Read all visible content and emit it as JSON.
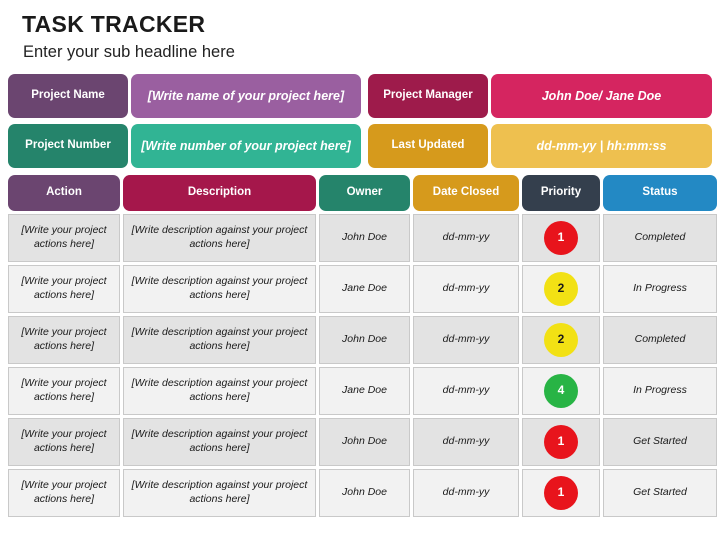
{
  "header": {
    "title": "TASK TRACKER",
    "subtitle": "Enter your sub headline here"
  },
  "meta": {
    "rows": [
      {
        "left": {
          "label": "Project Name",
          "value": "[Write name of your project here]",
          "label_color": "#6B4570",
          "value_color": "#9A5FA0"
        },
        "right": {
          "label": "Project Manager",
          "value": "John Doe/ Jane Doe",
          "label_color": "#9E1B4B",
          "value_color": "#D52560"
        }
      },
      {
        "left": {
          "label": "Project Number",
          "value": "[Write number of your project here]",
          "label_color": "#25846B",
          "value_color": "#31B494"
        },
        "right": {
          "label": "Last Updated",
          "value": "dd-mm-yy | hh:mm:ss",
          "label_color": "#D69A1C",
          "value_color": "#EEC04F"
        }
      }
    ]
  },
  "table": {
    "columns": [
      {
        "label": "Action",
        "color": "#6B4570"
      },
      {
        "label": "Description",
        "color": "#A5174B"
      },
      {
        "label": "Owner",
        "color": "#25846B"
      },
      {
        "label": "Date Closed",
        "color": "#D69A1C"
      },
      {
        "label": "Priority",
        "color": "#343F4D"
      },
      {
        "label": "Status",
        "color": "#2389C4"
      }
    ],
    "rows": [
      {
        "action": "[Write your project actions here]",
        "description": "[Write description against your project actions here]",
        "owner": "John Doe",
        "date_closed": "dd-mm-yy",
        "priority": {
          "value": "1",
          "color": "#E8141C",
          "text_color": "#ffffff"
        },
        "status": "Completed"
      },
      {
        "action": "[Write your project actions here]",
        "description": "[Write description against your project actions here]",
        "owner": "Jane Doe",
        "date_closed": "dd-mm-yy",
        "priority": {
          "value": "2",
          "color": "#F2E114",
          "text_color": "#1a1a1a"
        },
        "status": "In Progress"
      },
      {
        "action": "[Write your project actions here]",
        "description": "[Write description against your project actions here]",
        "owner": "John Doe",
        "date_closed": "dd-mm-yy",
        "priority": {
          "value": "2",
          "color": "#F2E114",
          "text_color": "#1a1a1a"
        },
        "status": "Completed"
      },
      {
        "action": "[Write your project actions here]",
        "description": "[Write description against your project actions here]",
        "owner": "Jane Doe",
        "date_closed": "dd-mm-yy",
        "priority": {
          "value": "4",
          "color": "#28B445",
          "text_color": "#ffffff"
        },
        "status": "In Progress"
      },
      {
        "action": "[Write your project actions here]",
        "description": "[Write description against your project actions here]",
        "owner": "John Doe",
        "date_closed": "dd-mm-yy",
        "priority": {
          "value": "1",
          "color": "#E8141C",
          "text_color": "#ffffff"
        },
        "status": "Get Started"
      },
      {
        "action": "[Write your project actions here]",
        "description": "[Write description against your project actions here]",
        "owner": "John Doe",
        "date_closed": "dd-mm-yy",
        "priority": {
          "value": "1",
          "color": "#E8141C",
          "text_color": "#ffffff"
        },
        "status": "Get Started"
      }
    ]
  }
}
